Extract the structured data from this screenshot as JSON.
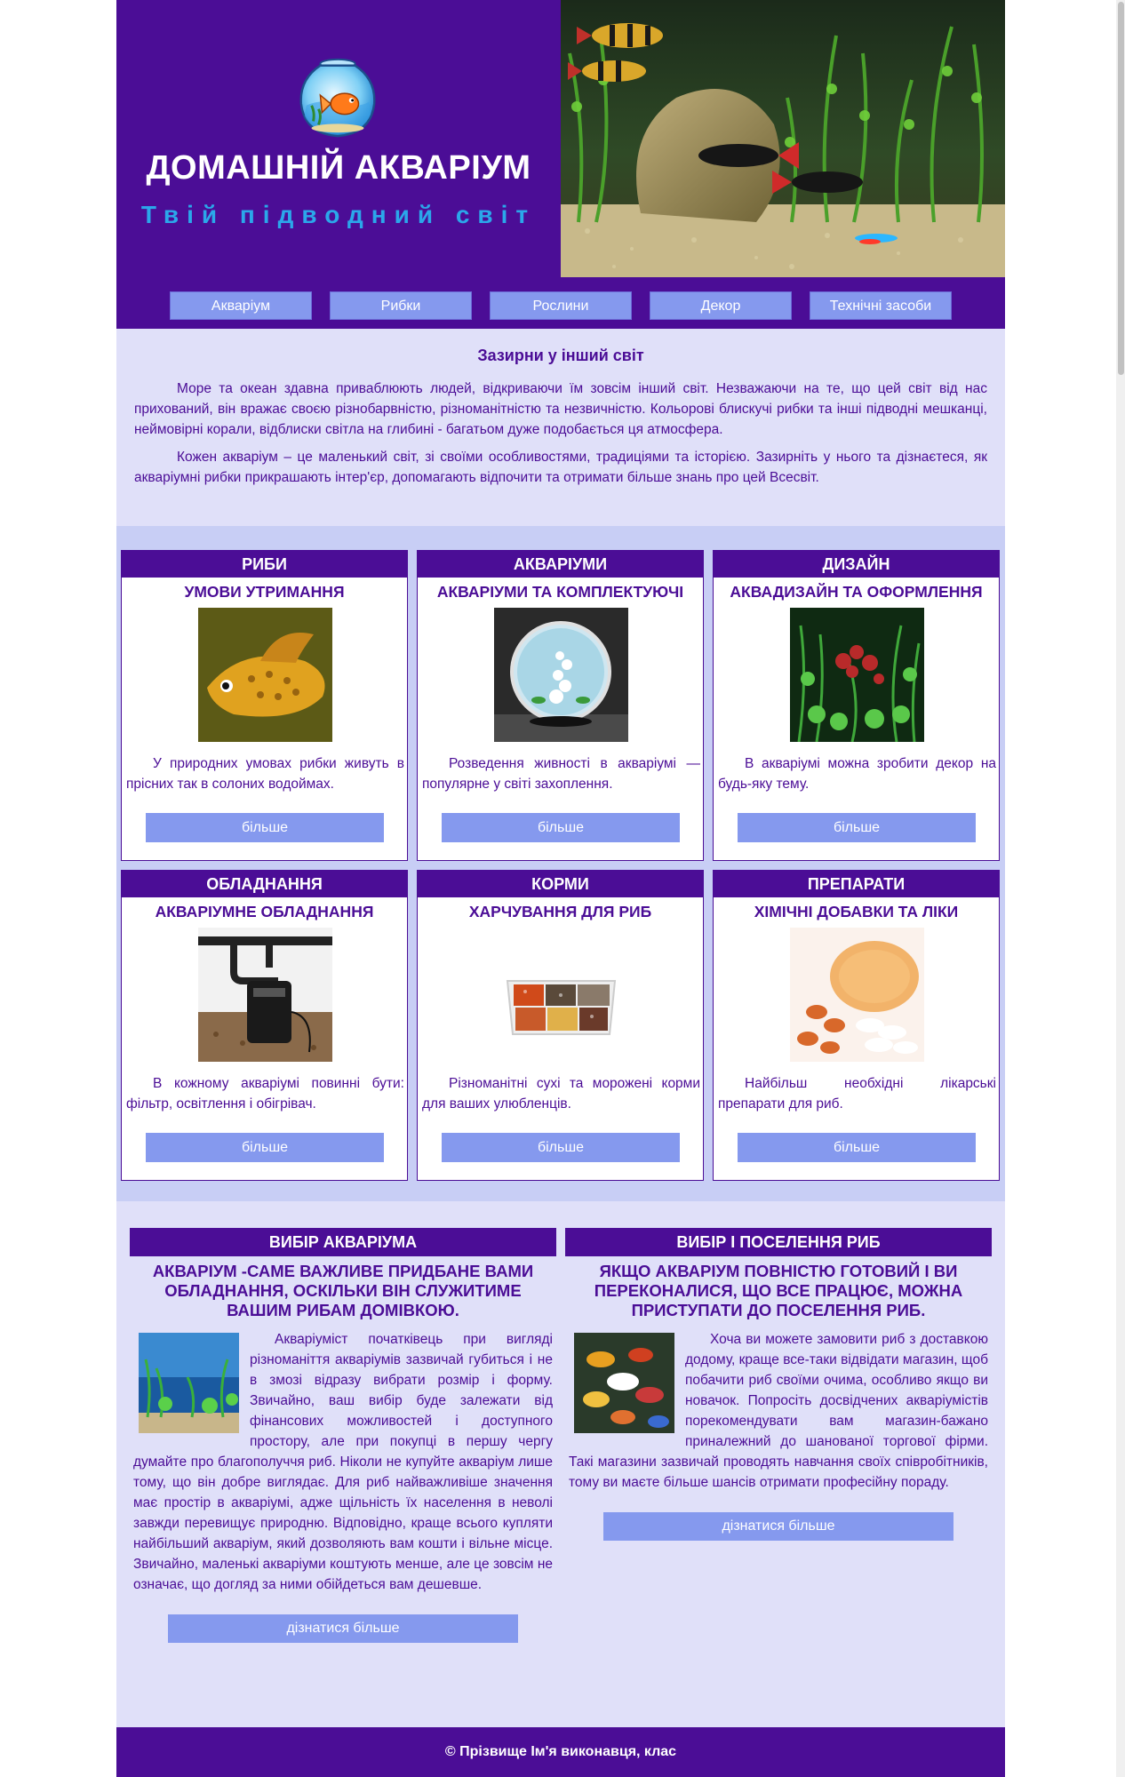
{
  "header": {
    "title": "ДОМАШНІЙ АКВАРІУМ",
    "subtitle": "Твій підводний світ",
    "logo_icon": "fishbowl-icon"
  },
  "nav": {
    "items": [
      "Акваріум",
      "Рибки",
      "Рослини",
      "Декор",
      "Технічні засоби"
    ]
  },
  "intro": {
    "heading": "Зазирни у інший світ",
    "paragraphs": [
      "Море та океан здавна приваблюють людей, відкриваючи їм зовсім інший світ. Незважаючи на те, що цей світ від нас прихований, він вражає своєю різнобарвністю, різноманітністю та незвичністю. Кольорові блискучі рибки та інші підводні мешканці, неймовірні корали, відблиски світла на глибині - багатьом дуже подобається ця атмосфера.",
      "Кожен акваріум – це маленький світ, зі своїми особливостями, традиціями та історією. Зазирніть у нього та дізнаєтеся, як акваріумні рибки прикрашають інтер'єр, допомагають відпочити та отримати більше знань про цей Всесвіт."
    ]
  },
  "cards": [
    {
      "head": "РИБИ",
      "sub": "УМОВИ УТРИМАННЯ",
      "text": "У природних умовах рибки живуть в прісних так в солоних водоймах.",
      "button": "більше",
      "image": "goldfish-photo"
    },
    {
      "head": "АКВАРІУМИ",
      "sub": "АКВАРІУМИ ТА КОМПЛЕКТУЮЧІ",
      "text": "Розведення живності в акваріумі — популярне у світі захоплення.",
      "button": "більше",
      "image": "round-aquarium-photo"
    },
    {
      "head": "ДИЗАЙН",
      "sub": "АКВАДИЗАЙН ТА ОФОРМЛЕННЯ",
      "text": "В акваріумі можна зробити декор на будь-яку тему.",
      "button": "більше",
      "image": "aquascape-photo"
    },
    {
      "head": "ОБЛАДНАННЯ",
      "sub": "АКВАРІУМНЕ ОБЛАДНАННЯ",
      "text": "В кожному акваріумі повинні бути: фільтр, освітлення і обігрівач.",
      "button": "більше",
      "image": "filter-photo"
    },
    {
      "head": "КОРМИ",
      "sub": "ХАРЧУВАННЯ ДЛЯ РИБ",
      "text": "Різноманітні сухі та морожені корми для ваших улюбленців.",
      "button": "більше",
      "image": "fish-food-photo"
    },
    {
      "head": "ПРЕПАРАТИ",
      "sub": "ХІМІЧНІ ДОБАВКИ ТА ЛІКИ",
      "text": "Найбільш необхідні лікарські препарати для риб.",
      "button": "більше",
      "image": "pills-photo"
    }
  ],
  "left_col": {
    "head": "ВИБІР АКВАРІУМА",
    "sub": "АКВАРІУМ -САМЕ ВАЖЛИВЕ ПРИДБАНЕ ВАМИ ОБЛАДНАННЯ, ОСКІЛЬКИ ВІН СЛУЖИТИМЕ ВАШИМ РИБАМ ДОМІВКОЮ.",
    "text": "Акваріуміст початківець при вигляді різноманіття акваріумів зазвичай губиться і не в змозі відразу вибрати розмір і форму. Звичайно, ваш вибір буде залежати від фінансових можливостей і доступного простору, але при покупці в першу чергу думайте про благополуччя риб. Ніколи не купуйте акваріум лише тому, що він добре виглядає. Для риб найважливіше значення має простір в акваріумі, адже щільність їх населення в неволі завжди перевищує природню. Відповідно, краще всього купляти найбільший акваріум, який дозволяють вам кошти і вільне місце. Звичайно, маленькі акваріуми коштують менше, але це зовсім не означає, що догляд за ними обійдеться вам дешевше.",
    "button": "дізнатися більше"
  },
  "right_col": {
    "head": "ВИБІР І ПОСЕЛЕННЯ РИБ",
    "sub": "ЯКЩО АКВАРІУМ ПОВНІСТЮ ГОТОВИЙ І ВИ ПЕРЕКОНАЛИСЯ, ЩО ВСЕ ПРАЦЮЄ, МОЖНА ПРИСТУПАТИ ДО ПОСЕЛЕННЯ РИБ.",
    "text": "Хоча ви можете замовити риб з доставкою додому, краще все-таки відвідати магазин, щоб побачити риб своїми очима, особливо якщо ви новачок. Попросіть досвідчених акваріумістів порекомендувати вам магазин-бажано приналежний до шанованої торгової фірми. Такі магазини зазвичай проводять навчання своїх співробітників, тому ви маєте більше шансів отримати професійну пораду.",
    "button": "дізнатися більше"
  },
  "footer": {
    "text": "© Прізвище Ім'я виконавця, клас"
  },
  "colors": {
    "primary": "#4b0d96",
    "button": "#8599ee",
    "accent_text": "#2ba7ea",
    "bg_light": "#e0e0f9",
    "bg_cards": "#c8cef5"
  }
}
